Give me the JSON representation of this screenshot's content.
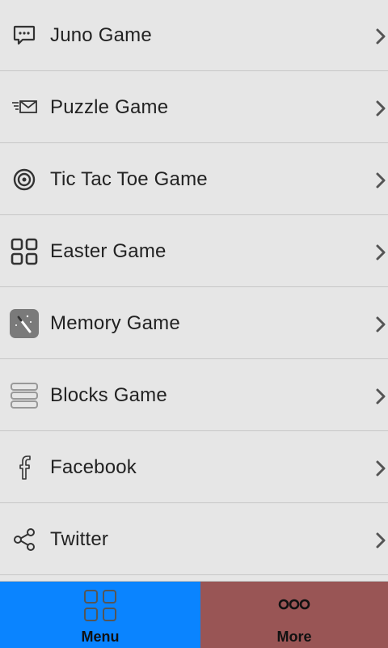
{
  "menu": {
    "items": [
      {
        "label": "Juno Game",
        "icon": "chat-bubble-icon"
      },
      {
        "label": "Puzzle Game",
        "icon": "mail-fast-icon"
      },
      {
        "label": "Tic Tac Toe Game",
        "icon": "target-icon"
      },
      {
        "label": "Easter Game",
        "icon": "grid-squares-icon"
      },
      {
        "label": "Memory Game",
        "icon": "magic-wand-icon"
      },
      {
        "label": "Blocks Game",
        "icon": "stacked-bars-icon"
      },
      {
        "label": "Facebook",
        "icon": "facebook-icon"
      },
      {
        "label": "Twitter",
        "icon": "share-icon"
      }
    ]
  },
  "tabbar": {
    "menu_label": "Menu",
    "more_label": "More",
    "menu_color": "#0a84ff",
    "more_color": "#995555"
  },
  "colors": {
    "background": "#e6e6e6",
    "separator": "#c8c8c8",
    "text": "#222222"
  }
}
